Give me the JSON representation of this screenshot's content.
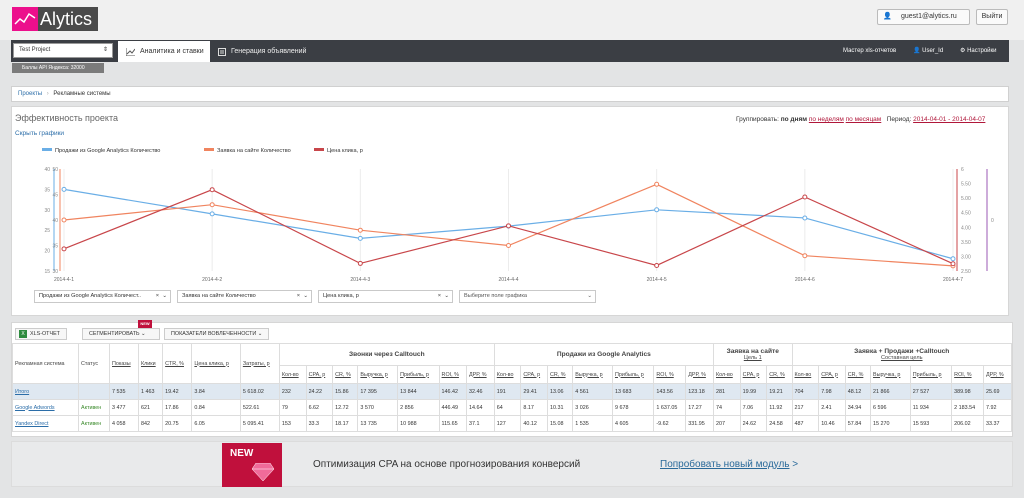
{
  "header": {
    "logo": "Alytics",
    "user": "guest1@alytics.ru",
    "logout": "Выйти"
  },
  "nav": {
    "project": "Test Project",
    "tabs": [
      "Аналитика и ставки",
      "Генерация объявлений"
    ],
    "report_master": "Мастер xls-отчетов",
    "user_id": "User_Id",
    "settings": "Настройки"
  },
  "badge": "Баллы API Яндекса: 32000",
  "breadcrumbs": [
    "Проекты",
    "Рекламные системы"
  ],
  "panel": {
    "title": "Эффективность проекта",
    "hide_charts": "Скрыть графики",
    "group_label": "Группировать:",
    "group_by_days": "по дням",
    "group_by_weeks": "по неделям",
    "group_by_months": "по месяцам",
    "period_label": "Период:",
    "period_value": "2014-04-01 - 2014-04-07"
  },
  "chart_data": {
    "type": "line",
    "x": [
      "2014-4-1",
      "2014-4-2",
      "2014-4-3",
      "2014-4-4",
      "2014-4-5",
      "2014-4-6",
      "2014-4-7"
    ],
    "series": [
      {
        "name": "Продажи из Google Analytics Количество",
        "color": "#6aaee6",
        "axis": "left1",
        "values": [
          35,
          29,
          23,
          26,
          30,
          28,
          18
        ]
      },
      {
        "name": "Заявка на сайте Количество",
        "color": "#f0845f",
        "axis": "left2",
        "values": [
          40,
          43,
          38,
          35,
          47,
          33,
          31
        ]
      },
      {
        "name": "Цена клика, р",
        "color": "#c8464a",
        "axis": "right1",
        "values": [
          3.26,
          5.29,
          2.76,
          4.05,
          2.69,
          5.04,
          2.75
        ]
      }
    ],
    "axes": {
      "left1": {
        "ticks": [
          "15",
          "20",
          "25",
          "30",
          "35",
          "40"
        ],
        "range": [
          15,
          40
        ],
        "color": "#6aaee6"
      },
      "left2": {
        "ticks": [
          "30",
          "35",
          "40",
          "45",
          "50"
        ],
        "range": [
          30,
          50
        ],
        "color": "#f0845f"
      },
      "right1": {
        "ticks": [
          "2.50",
          "3.00",
          "3.50",
          "4.00",
          "4.50",
          "5.00",
          "5.50",
          "6"
        ],
        "range": [
          2.5,
          6
        ],
        "color": "#c8464a"
      },
      "right2": {
        "ticks": [
          "0"
        ],
        "color": "#9b59b6"
      }
    },
    "legend": "top-left"
  },
  "selectors": [
    "Продажи из Google Analytics Количест..",
    "Заявка на сайте Количество",
    "Цена клика, р",
    "Выберите поле графика"
  ],
  "toolbar": {
    "xls": "XLS-ОТЧЕТ",
    "segment": "СЕГМЕНТИРОВАТЬ",
    "new": "NEW",
    "engagement": "ПОКАЗАТЕЛИ ВОВЛЕЧЕННОСТИ"
  },
  "table": {
    "fixed_headers": [
      "Рекламная система",
      "Статус",
      "Показы",
      "Клики",
      "CTR, %",
      "Цена клика, р",
      "Затраты, р"
    ],
    "groups": [
      {
        "title": "Звонки через Calltouch",
        "sub": ""
      },
      {
        "title": "Продажи из Google Analytics",
        "sub": ""
      },
      {
        "title": "Заявка на сайте",
        "sub": "Цель 1"
      },
      {
        "title": "Заявка + Продажи +Calltouch",
        "sub": "Составная цель"
      }
    ],
    "group_headers": [
      [
        "Кол-во",
        "CPA, р",
        "CR, %",
        "Выручка, р",
        "Прибыль, р",
        "ROI, %",
        "ДРР, %"
      ],
      [
        "Кол-во",
        "CPA, р",
        "CR, %",
        "Выручка, р",
        "Прибыль, р",
        "ROI, %",
        "ДРР, %"
      ],
      [
        "Кол-во",
        "CPA, р",
        "CR, %"
      ],
      [
        "Кол-во",
        "CPA, р",
        "CR, %",
        "Выручка, р",
        "Прибыль, р",
        "ROI, %",
        "ДРР, %"
      ]
    ],
    "rows": [
      {
        "name": "Итого",
        "status": "",
        "cells": [
          "7 535",
          "1 463",
          "19.42",
          "3.84",
          "5 618.02",
          "232",
          "24.22",
          "15.86",
          "17 395",
          "13 844",
          "146.42",
          "32.46",
          "191",
          "29.41",
          "13.06",
          "4 561",
          "13 683",
          "143.56",
          "123.18",
          "281",
          "19.99",
          "19.21",
          "704",
          "7.98",
          "48.12",
          "21 866",
          "27 527",
          "389.98",
          "25.69"
        ]
      },
      {
        "name": "Google Adwords",
        "status": "Активен",
        "cells": [
          "3 477",
          "621",
          "17.86",
          "0.84",
          "522.61",
          "79",
          "6.62",
          "12.72",
          "3 570",
          "2 856",
          "446.49",
          "14.64",
          "64",
          "8.17",
          "10.31",
          "3 026",
          "9 678",
          "1 637.05",
          "17.27",
          "74",
          "7.06",
          "11.92",
          "217",
          "2.41",
          "34.94",
          "6 596",
          "11 934",
          "2 183.54",
          "7.92"
        ]
      },
      {
        "name": "Yandex Direct",
        "status": "Активен",
        "cells": [
          "4 058",
          "842",
          "20.75",
          "6.05",
          "5 095.41",
          "153",
          "33.3",
          "18.17",
          "13 735",
          "10 988",
          "115.65",
          "37.1",
          "127",
          "40.12",
          "15.08",
          "1 535",
          "4 605",
          "-9.62",
          "331.95",
          "207",
          "24.62",
          "24.58",
          "487",
          "10.46",
          "57.84",
          "15 270",
          "15 593",
          "206.02",
          "33.37"
        ]
      }
    ]
  },
  "promo": {
    "new": "NEW",
    "text": "Оптимизация CPA на основе прогнозирования конверсий",
    "link": "Попробовать новый модуль",
    "arrow": ">"
  }
}
